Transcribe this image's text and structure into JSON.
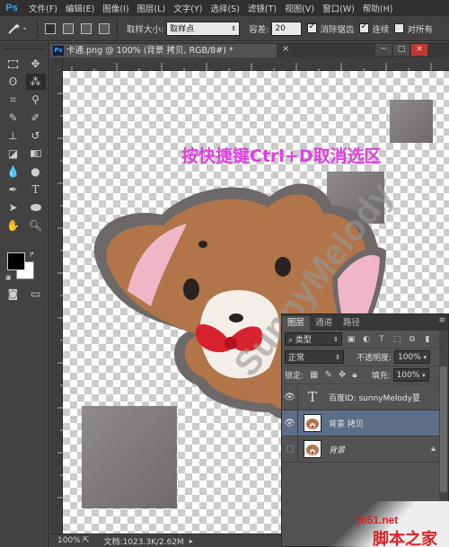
{
  "app": {
    "logo": "Ps"
  },
  "menu": [
    "文件(F)",
    "编辑(E)",
    "图像(I)",
    "图层(L)",
    "文字(Y)",
    "选择(S)",
    "滤镜(T)",
    "视图(V)",
    "窗口(W)",
    "帮助(H)"
  ],
  "options": {
    "sample_size_label": "取样大小:",
    "sample_size_value": "取样点",
    "tolerance_label": "容差:",
    "tolerance_value": "20",
    "antialias_label": "消除锯齿",
    "contiguous_label": "连续",
    "all_layers_label": "对所有"
  },
  "document": {
    "tab_title": "卡通.png @ 100% (背景 拷贝, RGB/8#) *",
    "close_glyph": "×"
  },
  "canvas": {
    "annotation": "按快捷键Ctrl+D取消选区",
    "watermark": "SunnyMelody"
  },
  "status": {
    "zoom": "100%",
    "doc_size": "文档:1023.3K/2.62M"
  },
  "layers_panel": {
    "tabs": [
      "图层",
      "通道",
      "路径"
    ],
    "filter_kind": "类型",
    "blend_mode": "正常",
    "opacity_label": "不透明度:",
    "opacity_value": "100%",
    "lock_label": "锁定:",
    "fill_label": "填充:",
    "fill_value": "100%",
    "layers": [
      {
        "name": "百度ID: sunnyMelody夏",
        "type": "text",
        "visible": true,
        "selected": false
      },
      {
        "name": "背景 拷贝",
        "type": "image",
        "visible": true,
        "selected": true
      },
      {
        "name": "背景",
        "type": "image",
        "visible": false,
        "selected": false,
        "locked": true
      }
    ]
  },
  "site": {
    "url": "jb51.net",
    "name": "脚本之家"
  },
  "colors": {
    "annotation": "#e040e0",
    "selected_layer": "#5d6f88",
    "foreground": "#000000",
    "background": "#ffffff"
  }
}
